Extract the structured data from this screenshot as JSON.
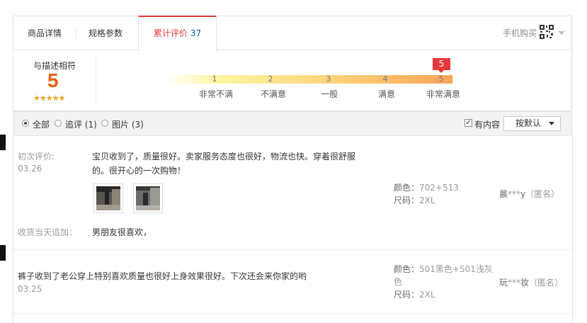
{
  "tabs": {
    "detail": "商品详情",
    "spec": "规格参数",
    "reviews_label": "累计评价",
    "reviews_count": "37",
    "mobile_buy": "手机购买"
  },
  "rating": {
    "title": "与描述相符",
    "score": "5",
    "stars": "★★★★★",
    "scale": [
      {
        "num": "1",
        "label": "非常不满"
      },
      {
        "num": "2",
        "label": "不满意"
      },
      {
        "num": "3",
        "label": "一般"
      },
      {
        "num": "4",
        "label": "满意"
      },
      {
        "num": "5",
        "label": "非常满意"
      }
    ],
    "marker": "5"
  },
  "filter": {
    "all": "全部",
    "followup": "追评 (1)",
    "pictures": "图片 (3)",
    "has_content": "有内容",
    "sort": "按默认"
  },
  "reviews": [
    {
      "initial_label": "初次评价:",
      "date": "03.26",
      "text_line1": "宝贝收到了，质量很好。卖家服务态度也很好，物流也快。穿着很舒服",
      "text_line2": "的。很开心的一次购物！",
      "color_label": "颜色：",
      "color_value": "702+513",
      "size_label": "尺码：",
      "size_value": "2XL",
      "user_prefix": "晨",
      "user_mask": "***",
      "user_suffix": "y",
      "anon": "（匿名）",
      "append_label": "收货当天追加：",
      "append_text": "男朋友很喜欢，"
    },
    {
      "text": "裤子收到了老公穿上特别喜欢质量也很好上身效果很好。下次还会来你家的哟",
      "date": "03.25",
      "color_label": "颜色：",
      "color_value_line1": "501黑色+501浅灰",
      "color_value_line2": "色",
      "size_label": "尺码：",
      "size_value": "2XL",
      "user_prefix": "玩",
      "user_mask": "***",
      "user_suffix": "妆",
      "anon": "（匿名）"
    }
  ]
}
